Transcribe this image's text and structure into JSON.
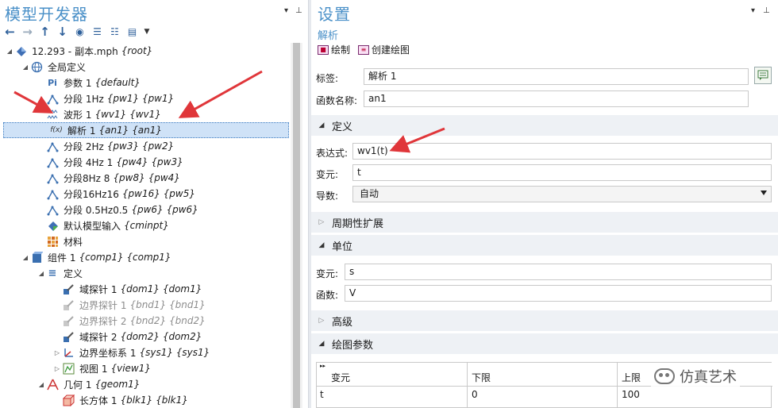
{
  "left_panel": {
    "title": "模型开发器",
    "tree": [
      {
        "label": "12.293 - 副本.mph",
        "tag": "{root}",
        "icon": "model-icon"
      },
      {
        "label": "全局定义",
        "tag": "",
        "icon": "globe-icon"
      },
      {
        "label": "参数 1",
        "tag": "{default}",
        "icon": "parameter-icon"
      },
      {
        "label": "分段 1Hz",
        "tag": "{pw1} {pw1}",
        "icon": "piecewise-icon"
      },
      {
        "label": "波形 1",
        "tag": "{wv1} {wv1}",
        "icon": "waveform-icon"
      },
      {
        "label": "解析 1",
        "tag": "{an1} {an1}",
        "icon": "analytic-icon"
      },
      {
        "label": "分段 2Hz",
        "tag": "{pw3} {pw2}",
        "icon": "piecewise-icon"
      },
      {
        "label": "分段 4Hz 1",
        "tag": "{pw4} {pw3}",
        "icon": "piecewise-icon"
      },
      {
        "label": "分段8Hz 8",
        "tag": "{pw8} {pw4}",
        "icon": "piecewise-icon"
      },
      {
        "label": "分段16Hz16",
        "tag": "{pw16} {pw5}",
        "icon": "piecewise-icon"
      },
      {
        "label": "分段 0.5Hz0.5",
        "tag": "{pw6} {pw6}",
        "icon": "piecewise-icon"
      },
      {
        "label": "默认模型输入",
        "tag": "{cminpt}",
        "icon": "model-input-icon"
      },
      {
        "label": "材料",
        "tag": "",
        "icon": "materials-icon"
      },
      {
        "label": "组件 1",
        "tag": "{comp1} {comp1}",
        "icon": "component-icon"
      },
      {
        "label": "定义",
        "tag": "",
        "icon": "definitions-icon"
      },
      {
        "label": "域探针 1",
        "tag": "{dom1} {dom1}",
        "icon": "probe-icon"
      },
      {
        "label": "边界探针 1",
        "tag": "{bnd1} {bnd1}",
        "icon": "probe-icon"
      },
      {
        "label": "边界探针 2",
        "tag": "{bnd2} {bnd2}",
        "icon": "probe-icon"
      },
      {
        "label": "域探针 2",
        "tag": "{dom2} {dom2}",
        "icon": "probe-icon"
      },
      {
        "label": "边界坐标系 1",
        "tag": "{sys1} {sys1}",
        "icon": "coordinate-system-icon"
      },
      {
        "label": "视图 1",
        "tag": "{view1}",
        "icon": "view-icon"
      },
      {
        "label": "几何 1",
        "tag": "{geom1}",
        "icon": "geometry-icon"
      },
      {
        "label": "长方体 1",
        "tag": "{blk1} {blk1}",
        "icon": "block-icon"
      }
    ]
  },
  "right_panel": {
    "title": "设置",
    "subtitle": "解析",
    "btn_plot": "绘制",
    "btn_create_plot": "创建绘图",
    "label_label": "标签:",
    "label_value": "解析 1",
    "funcname_label": "函数名称:",
    "funcname_value": "an1",
    "sec_definition": "定义",
    "expr_label": "表达式:",
    "expr_value": "wv1(t)",
    "var_label": "变元:",
    "var_value": "t",
    "deriv_label": "导数:",
    "deriv_value": "自动",
    "sec_periodic": "周期性扩展",
    "sec_units": "单位",
    "unit_var_label": "变元:",
    "unit_var_value": "s",
    "unit_func_label": "函数:",
    "unit_func_value": "V",
    "sec_advanced": "高级",
    "sec_plot_params": "绘图参数",
    "table": {
      "headers": [
        "变元",
        "下限",
        "上限"
      ],
      "row": [
        "t",
        "0",
        "100"
      ]
    }
  },
  "watermark": "仿真艺术",
  "colors": {
    "accent": "#4a90c8",
    "arrow": "#e0363a",
    "selection": "#cfe2f7"
  }
}
